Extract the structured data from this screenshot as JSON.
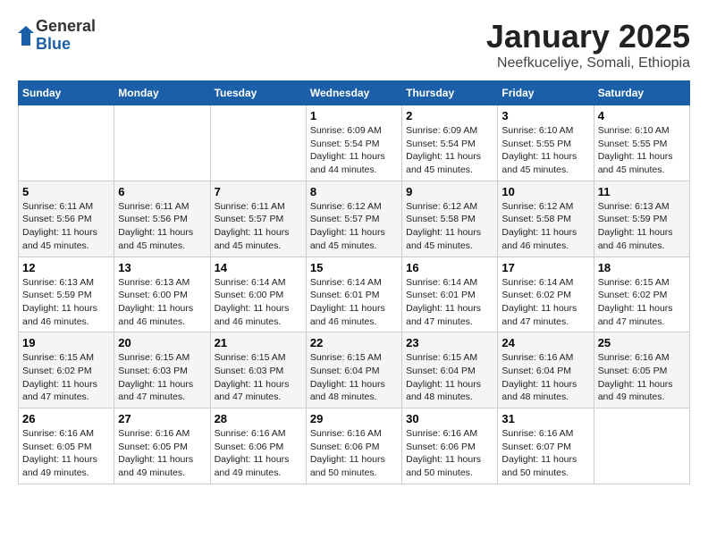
{
  "logo": {
    "general": "General",
    "blue": "Blue"
  },
  "title": "January 2025",
  "subtitle": "Neefkuceliye, Somali, Ethiopia",
  "days_of_week": [
    "Sunday",
    "Monday",
    "Tuesday",
    "Wednesday",
    "Thursday",
    "Friday",
    "Saturday"
  ],
  "weeks": [
    [
      {
        "day": "",
        "info": ""
      },
      {
        "day": "",
        "info": ""
      },
      {
        "day": "",
        "info": ""
      },
      {
        "day": "1",
        "info": "Sunrise: 6:09 AM\nSunset: 5:54 PM\nDaylight: 11 hours and 44 minutes."
      },
      {
        "day": "2",
        "info": "Sunrise: 6:09 AM\nSunset: 5:54 PM\nDaylight: 11 hours and 45 minutes."
      },
      {
        "day": "3",
        "info": "Sunrise: 6:10 AM\nSunset: 5:55 PM\nDaylight: 11 hours and 45 minutes."
      },
      {
        "day": "4",
        "info": "Sunrise: 6:10 AM\nSunset: 5:55 PM\nDaylight: 11 hours and 45 minutes."
      }
    ],
    [
      {
        "day": "5",
        "info": "Sunrise: 6:11 AM\nSunset: 5:56 PM\nDaylight: 11 hours and 45 minutes."
      },
      {
        "day": "6",
        "info": "Sunrise: 6:11 AM\nSunset: 5:56 PM\nDaylight: 11 hours and 45 minutes."
      },
      {
        "day": "7",
        "info": "Sunrise: 6:11 AM\nSunset: 5:57 PM\nDaylight: 11 hours and 45 minutes."
      },
      {
        "day": "8",
        "info": "Sunrise: 6:12 AM\nSunset: 5:57 PM\nDaylight: 11 hours and 45 minutes."
      },
      {
        "day": "9",
        "info": "Sunrise: 6:12 AM\nSunset: 5:58 PM\nDaylight: 11 hours and 45 minutes."
      },
      {
        "day": "10",
        "info": "Sunrise: 6:12 AM\nSunset: 5:58 PM\nDaylight: 11 hours and 46 minutes."
      },
      {
        "day": "11",
        "info": "Sunrise: 6:13 AM\nSunset: 5:59 PM\nDaylight: 11 hours and 46 minutes."
      }
    ],
    [
      {
        "day": "12",
        "info": "Sunrise: 6:13 AM\nSunset: 5:59 PM\nDaylight: 11 hours and 46 minutes."
      },
      {
        "day": "13",
        "info": "Sunrise: 6:13 AM\nSunset: 6:00 PM\nDaylight: 11 hours and 46 minutes."
      },
      {
        "day": "14",
        "info": "Sunrise: 6:14 AM\nSunset: 6:00 PM\nDaylight: 11 hours and 46 minutes."
      },
      {
        "day": "15",
        "info": "Sunrise: 6:14 AM\nSunset: 6:01 PM\nDaylight: 11 hours and 46 minutes."
      },
      {
        "day": "16",
        "info": "Sunrise: 6:14 AM\nSunset: 6:01 PM\nDaylight: 11 hours and 47 minutes."
      },
      {
        "day": "17",
        "info": "Sunrise: 6:14 AM\nSunset: 6:02 PM\nDaylight: 11 hours and 47 minutes."
      },
      {
        "day": "18",
        "info": "Sunrise: 6:15 AM\nSunset: 6:02 PM\nDaylight: 11 hours and 47 minutes."
      }
    ],
    [
      {
        "day": "19",
        "info": "Sunrise: 6:15 AM\nSunset: 6:02 PM\nDaylight: 11 hours and 47 minutes."
      },
      {
        "day": "20",
        "info": "Sunrise: 6:15 AM\nSunset: 6:03 PM\nDaylight: 11 hours and 47 minutes."
      },
      {
        "day": "21",
        "info": "Sunrise: 6:15 AM\nSunset: 6:03 PM\nDaylight: 11 hours and 47 minutes."
      },
      {
        "day": "22",
        "info": "Sunrise: 6:15 AM\nSunset: 6:04 PM\nDaylight: 11 hours and 48 minutes."
      },
      {
        "day": "23",
        "info": "Sunrise: 6:15 AM\nSunset: 6:04 PM\nDaylight: 11 hours and 48 minutes."
      },
      {
        "day": "24",
        "info": "Sunrise: 6:16 AM\nSunset: 6:04 PM\nDaylight: 11 hours and 48 minutes."
      },
      {
        "day": "25",
        "info": "Sunrise: 6:16 AM\nSunset: 6:05 PM\nDaylight: 11 hours and 49 minutes."
      }
    ],
    [
      {
        "day": "26",
        "info": "Sunrise: 6:16 AM\nSunset: 6:05 PM\nDaylight: 11 hours and 49 minutes."
      },
      {
        "day": "27",
        "info": "Sunrise: 6:16 AM\nSunset: 6:05 PM\nDaylight: 11 hours and 49 minutes."
      },
      {
        "day": "28",
        "info": "Sunrise: 6:16 AM\nSunset: 6:06 PM\nDaylight: 11 hours and 49 minutes."
      },
      {
        "day": "29",
        "info": "Sunrise: 6:16 AM\nSunset: 6:06 PM\nDaylight: 11 hours and 50 minutes."
      },
      {
        "day": "30",
        "info": "Sunrise: 6:16 AM\nSunset: 6:06 PM\nDaylight: 11 hours and 50 minutes."
      },
      {
        "day": "31",
        "info": "Sunrise: 6:16 AM\nSunset: 6:07 PM\nDaylight: 11 hours and 50 minutes."
      },
      {
        "day": "",
        "info": ""
      }
    ]
  ]
}
